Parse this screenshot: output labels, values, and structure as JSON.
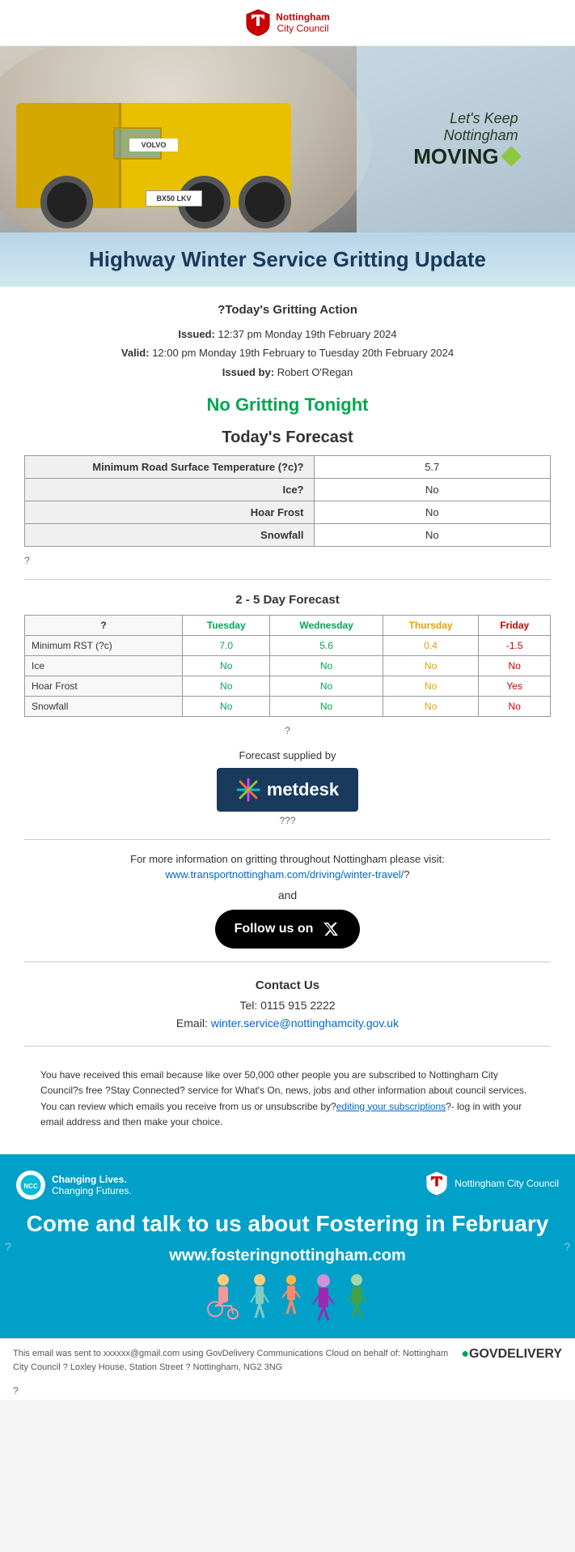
{
  "header": {
    "logo_text_line1": "Nottingham",
    "logo_text_line2": "City Council"
  },
  "hero": {
    "tagline_line1": "Let's Keep",
    "tagline_line2": "Nottingham",
    "tagline_bold": "MOVING"
  },
  "title_banner": {
    "title": "Highway Winter Service Gritting Update"
  },
  "gritting_action": {
    "question_prefix": "?",
    "title": "Today's Gritting Action",
    "issued_label": "Issued:",
    "issued_value": "12:37 pm Monday 19th February 2024",
    "valid_label": "Valid:",
    "valid_value": "12:00 pm Monday 19th February to Tuesday 20th February 2024",
    "issued_by_label": "Issued by:",
    "issued_by_value": "Robert O'Regan",
    "status": "No Gritting Tonight"
  },
  "todays_forecast": {
    "title": "Today's Forecast",
    "rows": [
      {
        "label": "Minimum Road Surface Temperature (?c)?",
        "value": "5.7"
      },
      {
        "label": "Ice?",
        "value": "No"
      },
      {
        "label": "Hoar Frost",
        "value": "No"
      },
      {
        "label": "Snowfall",
        "value": "No"
      }
    ]
  },
  "forecast_2_5": {
    "title": "2 - 5 Day Forecast",
    "columns": [
      "?",
      "Tuesday",
      "Wednesday",
      "Thursday",
      "Friday"
    ],
    "rows": [
      {
        "label": "Minimum RST (?c)",
        "values": [
          "7.0",
          "5.6",
          "0.4",
          "-1.5"
        ]
      },
      {
        "label": "Ice",
        "values": [
          "No",
          "No",
          "No",
          "No"
        ]
      },
      {
        "label": "Hoar Frost",
        "values": [
          "No",
          "No",
          "No",
          "Yes"
        ]
      },
      {
        "label": "Snowfall",
        "values": [
          "No",
          "No",
          "No",
          "No"
        ]
      }
    ],
    "question": "?"
  },
  "metdesk": {
    "forecast_supplied_by": "Forecast supplied by",
    "logo_star": "✳",
    "logo_name": "metdesk",
    "questions": "???"
  },
  "more_info": {
    "text": "For more information on gritting throughout Nottingham please visit:",
    "link_text": "www.transportnottingham.com/driving/winter-travel/",
    "link_url": "#",
    "link_suffix": "?",
    "and_text": "and"
  },
  "follow_us": {
    "label": "Follow us on"
  },
  "contact": {
    "title": "Contact Us",
    "tel_label": "Tel:",
    "tel_value": "0115 915 2222",
    "email_label": "Email:",
    "email_value": "winter.service@nottinghamcity.gov.uk",
    "email_link": "mailto:winter.service@nottinghamcity.gov.uk"
  },
  "subscription": {
    "text_before_link": "You have received this email because like over 50,000 other people you are subscribed to Nottingham City Council?s free ?Stay Connected? service for What's On, news, jobs and other information about council services. You can review which emails you receive from us or unsubscribe by?",
    "link_text": "editing your subscriptions",
    "text_after_link": "?- log in with your email address and then make your choice."
  },
  "fostering": {
    "logo_left_line1": "Changing Lives.",
    "logo_left_line2": "Changing Futures.",
    "logo_right": "Nottingham City Council",
    "main_text": "Come and talk to us about Fostering in February",
    "url": "www.fosteringnottingham.com",
    "side_left": "?",
    "side_right": "?"
  },
  "footer": {
    "text": "This email was sent to xxxxxx@gmail.com using GovDelivery Communications Cloud on behalf of: Nottingham City Council ? Loxley House, Station Street ? Nottingham, NG2 3NG",
    "logo": "GOVDELIVERY"
  },
  "bottom": {
    "question": "?"
  }
}
